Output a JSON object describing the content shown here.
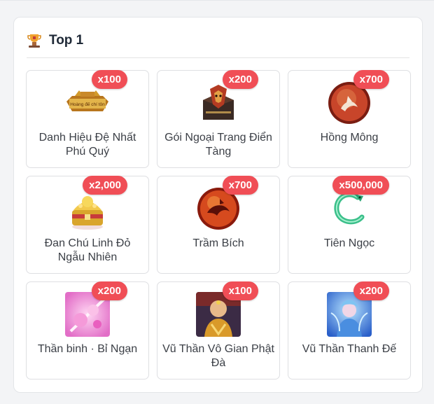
{
  "panel": {
    "title": "Top 1",
    "icon": "trophy-icon"
  },
  "items": [
    {
      "name": "Danh Hiệu Đệ Nhất Phú Quý",
      "qty": "x100",
      "image_text": "Hoàng đế chí tôn",
      "icon": "gold-title-plaque-icon"
    },
    {
      "name": "Gói Ngoại Trang Điển Tàng",
      "qty": "x200",
      "icon": "dark-chest-icon"
    },
    {
      "name": "Hồng Mông",
      "qty": "x700",
      "icon": "red-orb-icon"
    },
    {
      "name": "Đan Chú Linh Đỏ Ngẫu Nhiên",
      "qty": "x2,000",
      "icon": "gold-treasure-chest-icon"
    },
    {
      "name": "Trầm Bích",
      "qty": "x700",
      "icon": "red-dragon-orb-icon"
    },
    {
      "name": "Tiên Ngọc",
      "qty": "x500,000",
      "icon": "jade-serpent-icon"
    },
    {
      "name": "Thần binh · Bỉ Ngạn",
      "qty": "x200",
      "icon": "pink-flower-weapon-icon"
    },
    {
      "name": "Vũ Thần Vô Gian Phật Đà",
      "qty": "x100",
      "icon": "buddha-warrior-portrait-icon"
    },
    {
      "name": "Vũ Thần Thanh Đế",
      "qty": "x200",
      "icon": "blue-fairy-portrait-icon"
    }
  ]
}
